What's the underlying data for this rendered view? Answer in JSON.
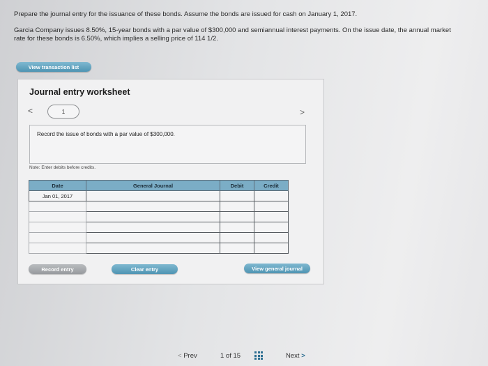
{
  "instructions": {
    "line1": "Prepare the journal entry for the issuance of these bonds. Assume the bonds are issued for cash on January 1, 2017.",
    "line2": "Garcia Company issues 8.50%, 15-year bonds with a par value of $300,000 and semiannual interest payments. On the issue date, the annual market rate for these bonds is 6.50%, which implies a selling price of 114 1/2."
  },
  "buttons": {
    "view_transaction_list": "View transaction list",
    "record_entry": "Record entry",
    "clear_entry": "Clear entry",
    "view_general_journal": "View general journal"
  },
  "worksheet": {
    "title": "Journal entry worksheet",
    "prev_arrow": "<",
    "next_arrow": ">",
    "current_step": "1",
    "prompt": "Record the issue of bonds with a par value of $300,000.",
    "note": "Note: Enter debits before credits.",
    "columns": [
      "Date",
      "General Journal",
      "Debit",
      "Credit"
    ],
    "rows": [
      {
        "date": "Jan 01, 2017",
        "account": "",
        "debit": "",
        "credit": ""
      },
      {
        "date": "",
        "account": "",
        "debit": "",
        "credit": ""
      },
      {
        "date": "",
        "account": "",
        "debit": "",
        "credit": ""
      },
      {
        "date": "",
        "account": "",
        "debit": "",
        "credit": ""
      },
      {
        "date": "",
        "account": "",
        "debit": "",
        "credit": ""
      },
      {
        "date": "",
        "account": "",
        "debit": "",
        "credit": ""
      }
    ]
  },
  "pagination": {
    "prev_label": "Prev",
    "prev_chevron": "<",
    "page_info": "1 of 15",
    "next_label": "Next",
    "next_chevron": ">"
  },
  "colors": {
    "table_header": "#7badc6",
    "button_teal": "#4e94b3",
    "button_grey": "#979a9e",
    "link_blue": "#2e6f92"
  },
  "icons": {
    "step_grid": "grid-icon"
  }
}
